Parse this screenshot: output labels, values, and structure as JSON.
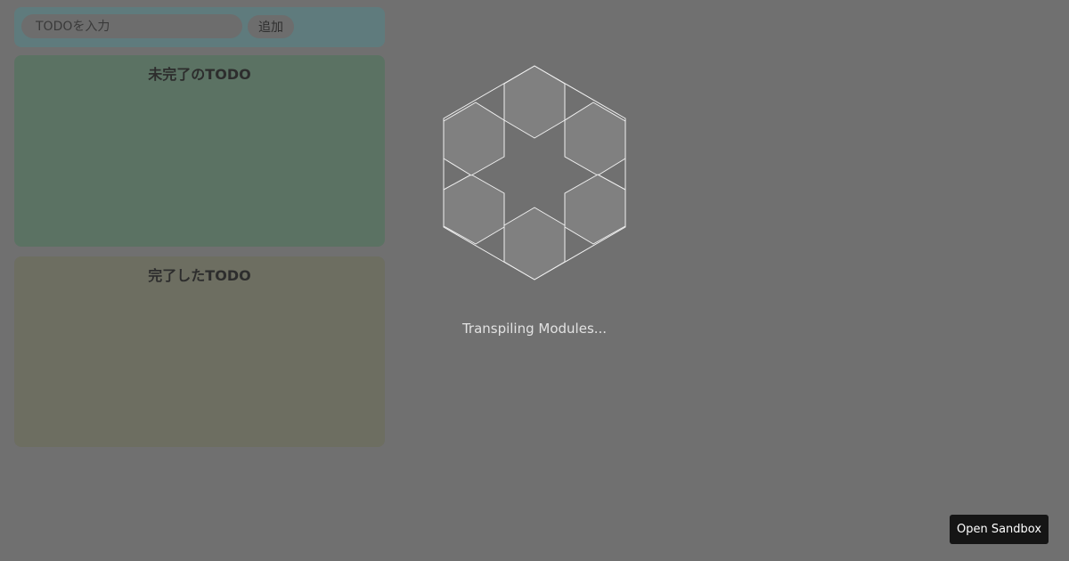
{
  "todo_input": {
    "placeholder": "TODOを入力"
  },
  "add_button": {
    "label": "追加"
  },
  "incomplete_section": {
    "title": "未完了のTODO",
    "items": []
  },
  "complete_section": {
    "title": "完了したTODO",
    "items": []
  },
  "loading": {
    "status_text": "Transpiling Modules...",
    "icon": "codesandbox-hexagon-loader-icon"
  },
  "open_sandbox": {
    "label": "Open Sandbox"
  },
  "colors": {
    "overlay_bg": "#707070",
    "input_area_bg": "#5f7b7d",
    "incomplete_panel_bg": "#5b7263",
    "complete_panel_bg": "#6d6e61",
    "loader_stroke": "#f0f0f0",
    "loader_fill": "#808080",
    "open_sandbox_bg": "#151515"
  }
}
